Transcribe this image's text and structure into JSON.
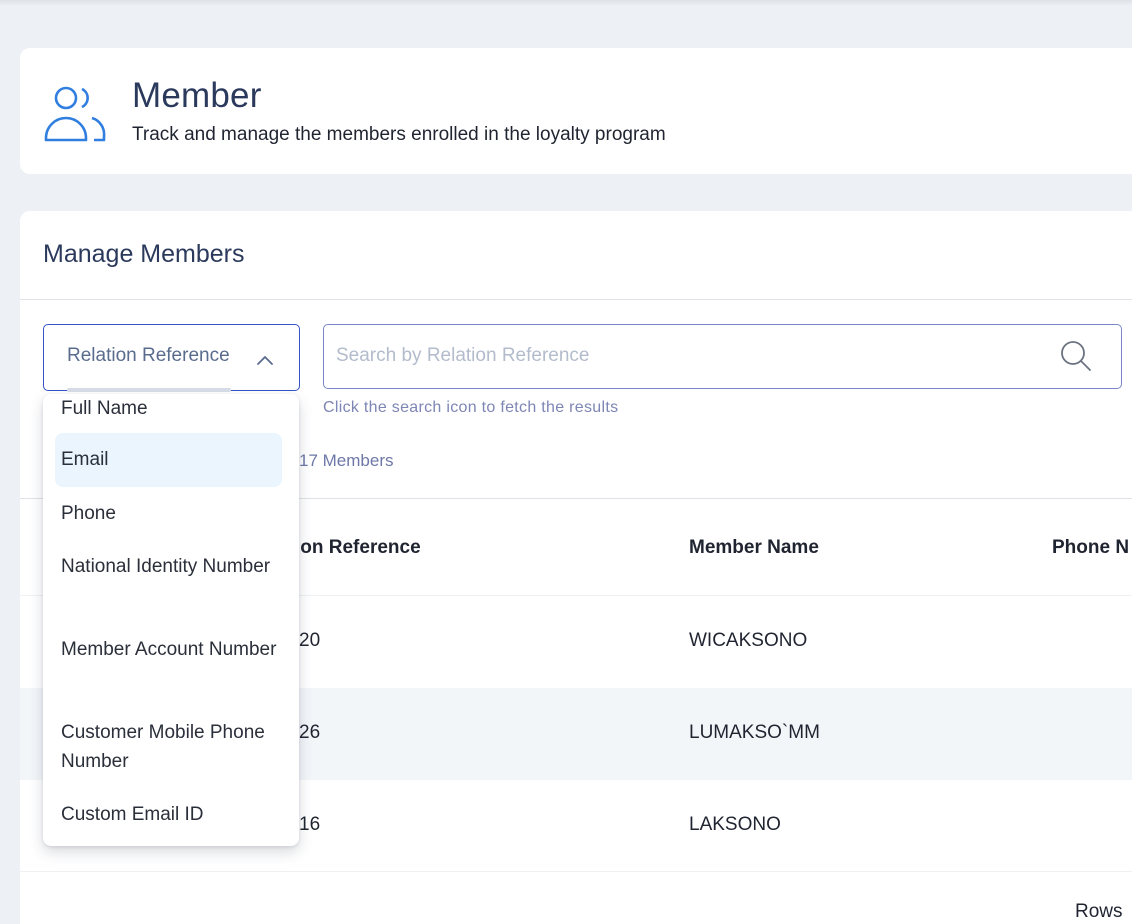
{
  "header": {
    "title": "Member",
    "subtitle": "Track and manage the members enrolled in the loyalty program",
    "icon": "users-icon"
  },
  "manage": {
    "title": "Manage Members",
    "search_field_select": {
      "value": "Relation Reference",
      "expanded": true
    },
    "search": {
      "placeholder": "Search by Relation Reference",
      "helper": "Click the search icon to fetch the results"
    },
    "count_text": "17 Members"
  },
  "dropdown": {
    "options": [
      {
        "label": "Full Name"
      },
      {
        "label": "Email",
        "highlighted": true
      },
      {
        "label": "Phone"
      },
      {
        "label": "National Identity Number"
      },
      {
        "label": "Member Account Number"
      },
      {
        "label": "Customer Mobile Phone Number"
      },
      {
        "label": "Custom Email ID"
      }
    ]
  },
  "table": {
    "columns": [
      "ion Reference",
      "Member Name",
      "Phone N"
    ],
    "rows": [
      {
        "ref": "20",
        "name": "WICAKSONO"
      },
      {
        "ref": "26",
        "name": "LUMAKSO`MM"
      },
      {
        "ref": "16",
        "name": "LAKSONO"
      }
    ]
  },
  "footer": {
    "rows_label": "Rows"
  },
  "colors": {
    "accent": "#3454c6",
    "title": "#2b3a5c",
    "icon": "#2f7ee0"
  }
}
